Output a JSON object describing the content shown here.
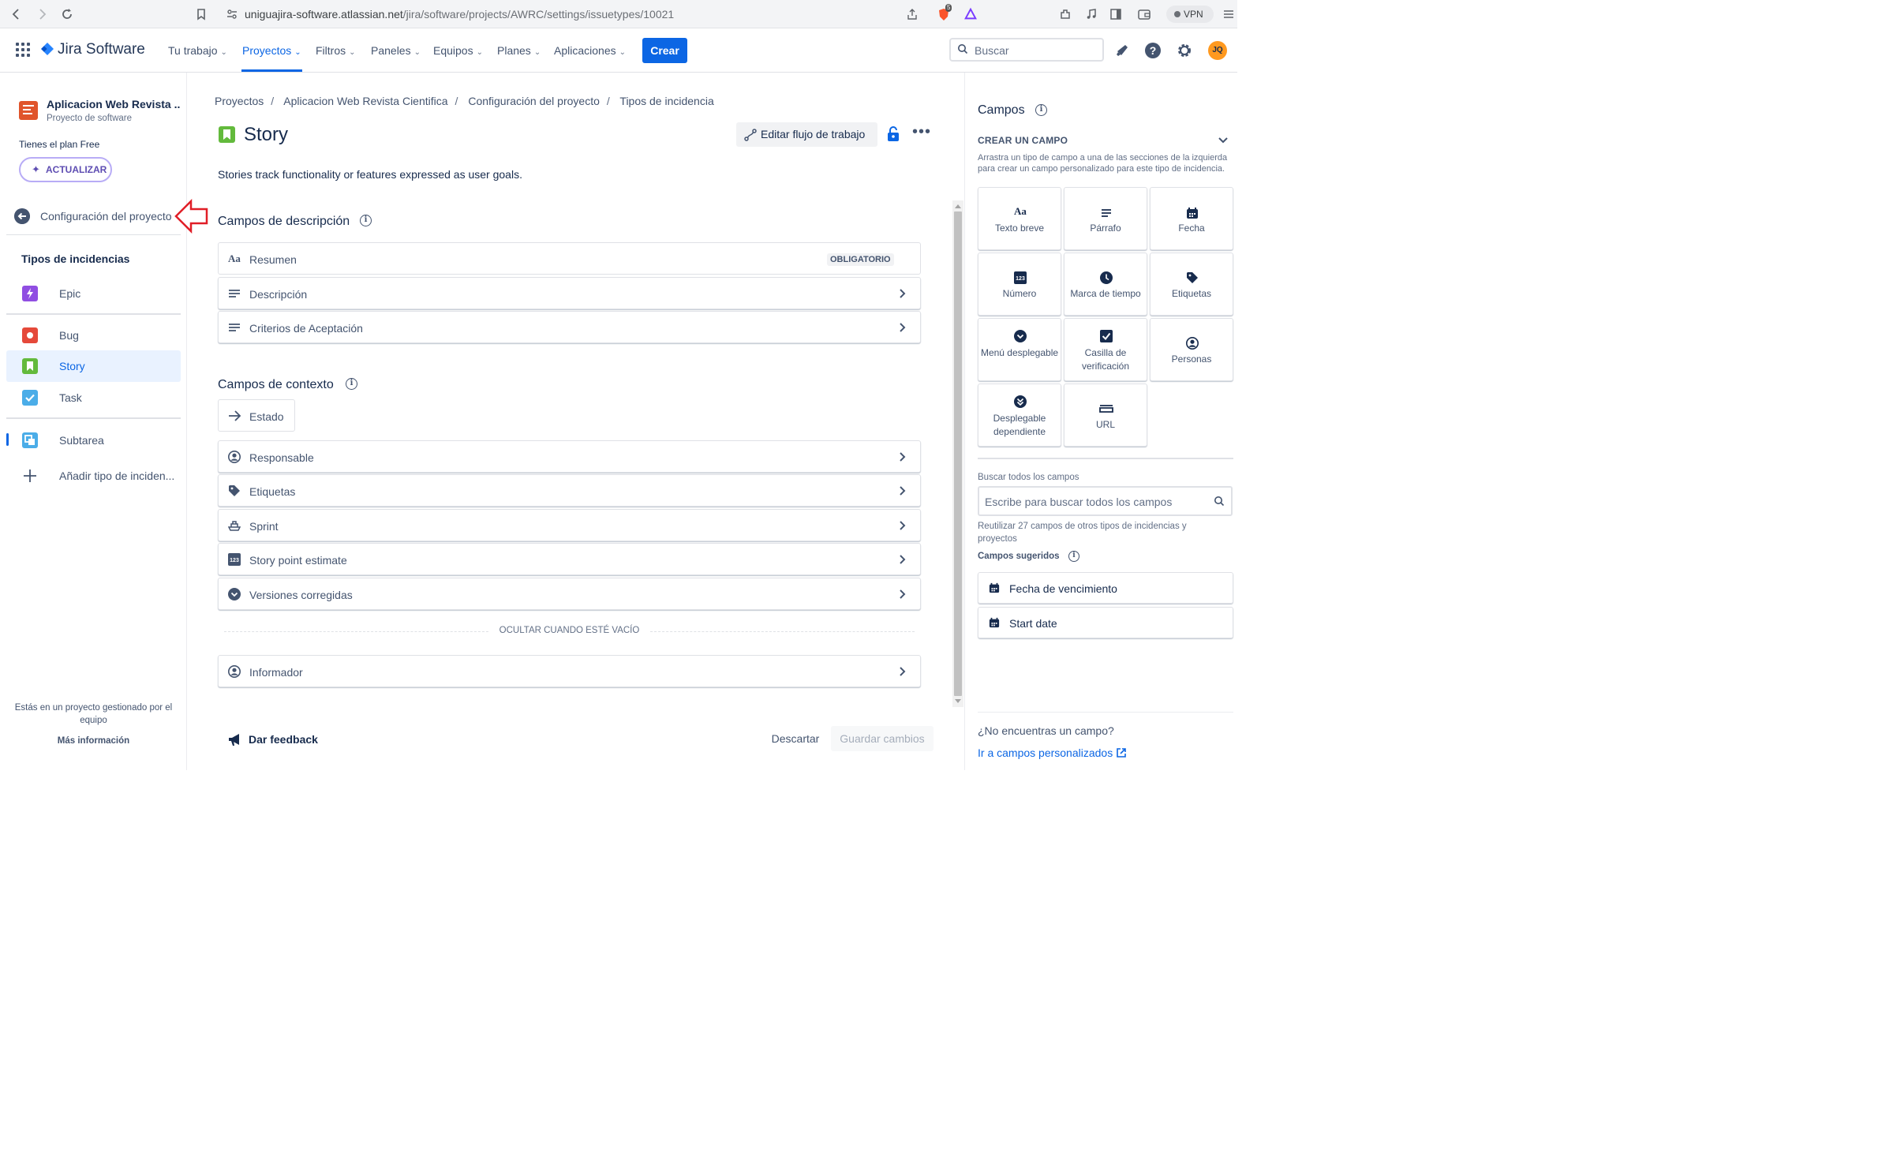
{
  "browser": {
    "url_host": "uniguajira-software.atlassian.net",
    "url_path": "/jira/software/projects/AWRC/settings/issuetypes/10021",
    "badge_count": "5",
    "vpn_label": "VPN"
  },
  "header": {
    "product_name": "Jira Software",
    "nav": [
      {
        "label": "Tu trabajo"
      },
      {
        "label": "Proyectos"
      },
      {
        "label": "Filtros"
      },
      {
        "label": "Paneles"
      },
      {
        "label": "Equipos"
      },
      {
        "label": "Planes"
      },
      {
        "label": "Aplicaciones"
      }
    ],
    "create_label": "Crear",
    "search_placeholder": "Buscar",
    "avatar_initials": "JQ",
    "colors": {
      "primary": "#0c66e4",
      "avatar": "#ff991f"
    }
  },
  "sidebar": {
    "project_name": "Aplicacion Web Revista ...",
    "project_type": "Proyecto de software",
    "plan_text": "Tienes el plan Free",
    "upgrade_label": "ACTUALIZAR",
    "back_label": "Configuración del proyecto",
    "types_title": "Tipos de incidencias",
    "items": [
      {
        "label": "Epic",
        "color": "#904ee2"
      },
      {
        "label": "Bug",
        "color": "#e5493a"
      },
      {
        "label": "Story",
        "color": "#63ba3c"
      },
      {
        "label": "Task",
        "color": "#4bade8"
      },
      {
        "label": "Subtarea",
        "color": "#4bade8"
      },
      {
        "label": "Añadir tipo de inciden..."
      }
    ],
    "footer_text": "Estás en un proyecto gestionado por el equipo",
    "footer_link": "Más información"
  },
  "main": {
    "breadcrumb": [
      "Proyectos",
      "Aplicacion Web Revista Cientifica",
      "Configuración del proyecto",
      "Tipos de incidencia"
    ],
    "title": "Story",
    "edit_workflow_label": "Editar flujo de trabajo",
    "description": "Stories track functionality or features expressed as user goals.",
    "description_fields_title": "Campos de descripción",
    "description_fields": [
      {
        "label": "Resumen",
        "badge": "OBLIGATORIO"
      },
      {
        "label": "Descripción"
      },
      {
        "label": "Criterios de Aceptación"
      }
    ],
    "context_fields_title": "Campos de contexto",
    "status_field": "Estado",
    "context_fields": [
      {
        "label": "Responsable"
      },
      {
        "label": "Etiquetas"
      },
      {
        "label": "Sprint"
      },
      {
        "label": "Story point estimate"
      },
      {
        "label": "Versiones corregidas"
      }
    ],
    "hide_when_empty": "OCULTAR CUANDO ESTÉ VACÍO",
    "hidden_fields": [
      {
        "label": "Informador"
      }
    ],
    "feedback_label": "Dar feedback",
    "discard_label": "Descartar",
    "save_label": "Guardar cambios"
  },
  "right_panel": {
    "title": "Campos",
    "create_title": "CREAR UN CAMPO",
    "create_desc": "Arrastra un tipo de campo a una de las secciones de la izquierda para crear un campo personalizado para este tipo de incidencia.",
    "tiles": [
      {
        "label": "Texto breve",
        "icon": "text-icon"
      },
      {
        "label": "Párrafo",
        "icon": "paragraph-icon"
      },
      {
        "label": "Fecha",
        "icon": "calendar-icon"
      },
      {
        "label": "Número",
        "icon": "number-icon"
      },
      {
        "label": "Marca de tiempo",
        "icon": "clock-icon"
      },
      {
        "label": "Etiquetas",
        "icon": "tag-icon"
      },
      {
        "label": "Menú desplegable",
        "icon": "dropdown-icon"
      },
      {
        "label": "Casilla de verificación",
        "icon": "checkbox-icon"
      },
      {
        "label": "Personas",
        "icon": "person-icon"
      },
      {
        "label": "Desplegable dependiente",
        "icon": "cascade-icon"
      },
      {
        "label": "URL",
        "icon": "link-icon"
      }
    ],
    "search_label": "Buscar todos los campos",
    "search_placeholder": "Escribe para buscar todos los campos",
    "reuse_text": "Reutilizar 27 campos de otros tipos de incidencias y proyectos",
    "suggested_title": "Campos sugeridos",
    "suggested": [
      {
        "label": "Fecha de vencimiento"
      },
      {
        "label": "Start date"
      }
    ],
    "no_field_text": "¿No encuentras un campo?",
    "custom_fields_link": "Ir a campos personalizados"
  }
}
